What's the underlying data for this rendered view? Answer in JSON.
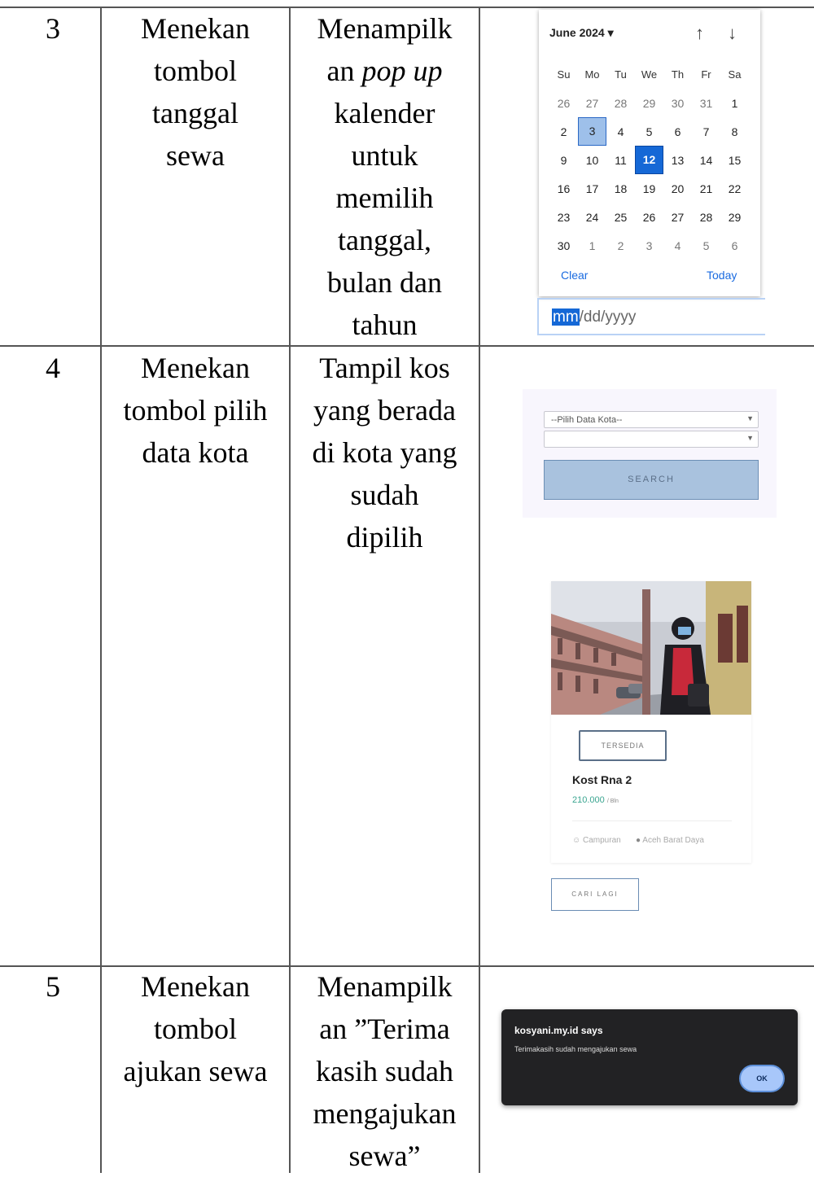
{
  "rows": [
    {
      "no": "3",
      "action": [
        "Menekan",
        "tombol",
        "tanggal",
        "sewa"
      ],
      "result_html_lines": [
        "Menampilk",
        "an |pop up|",
        "kalender",
        "untuk",
        "memilih",
        "tanggal,",
        "bulan dan",
        "tahun"
      ]
    },
    {
      "no": "4",
      "action": [
        "Menekan",
        "tombol pilih",
        "data kota"
      ],
      "result_html_lines": [
        "Tampil kos",
        "yang berada",
        "di kota yang",
        "sudah",
        "dipilih"
      ]
    },
    {
      "no": "5",
      "action": [
        "Menekan",
        "tombol",
        "ajukan sewa"
      ],
      "result_html_lines": [
        "Menampilk",
        "an ”Terima",
        "kasih sudah",
        "mengajukan",
        "sewa”"
      ]
    }
  ],
  "calendar": {
    "month_label": "June 2024 ▾",
    "up_arrow": "↑",
    "down_arrow": "↓",
    "weekdays": [
      "Su",
      "Mo",
      "Tu",
      "We",
      "Th",
      "Fr",
      "Sa"
    ],
    "weeks": [
      [
        "26",
        "27",
        "28",
        "29",
        "30",
        "31",
        "1"
      ],
      [
        "2",
        "3",
        "4",
        "5",
        "6",
        "7",
        "8"
      ],
      [
        "9",
        "10",
        "11",
        "12",
        "13",
        "14",
        "15"
      ],
      [
        "16",
        "17",
        "18",
        "19",
        "20",
        "21",
        "22"
      ],
      [
        "23",
        "24",
        "25",
        "26",
        "27",
        "28",
        "29"
      ],
      [
        "30",
        "1",
        "2",
        "3",
        "4",
        "5",
        "6"
      ]
    ],
    "selected_day": "3",
    "today_day": "12",
    "clear_label": "Clear",
    "today_label": "Today",
    "input_highlight": "mm",
    "input_rest": "/dd/yyyy"
  },
  "filter": {
    "city_select": "--Pilih Data Kota--",
    "second_select": "",
    "search_label": "SEARCH"
  },
  "listing": {
    "status": "TERSEDIA",
    "name": "Kost Rna 2",
    "price": "210.000",
    "price_unit": "/ Bln",
    "type": "Campuran",
    "location": "Aceh Barat Daya",
    "cari_lagi": "CARI LAGI"
  },
  "dialog": {
    "title": "kosyani.my.id says",
    "message": "Terimakasih sudah mengajukan sewa",
    "ok": "OK"
  },
  "colors": {
    "grid": "#555555",
    "calendar_today": "#1568d6",
    "calendar_selected": "#9ec0ea",
    "search_button": "#a9c2de",
    "price": "#3aa590",
    "dialog_bg": "#222224",
    "ok_button": "#a8c7fa"
  }
}
